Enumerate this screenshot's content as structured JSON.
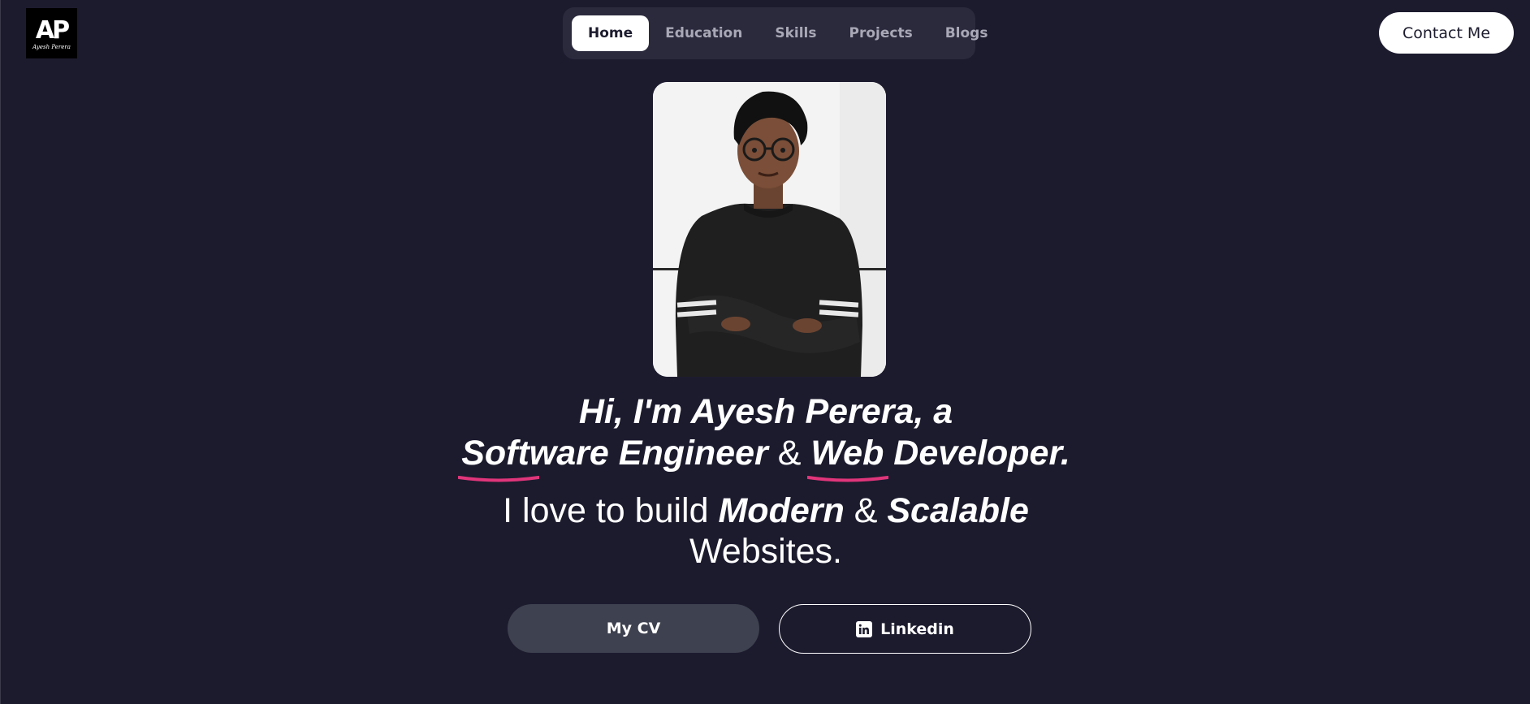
{
  "logo": {
    "mark": "AP",
    "signature": "Ayesh Perera"
  },
  "nav": {
    "items": [
      {
        "label": "Home",
        "active": true
      },
      {
        "label": "Education",
        "active": false
      },
      {
        "label": "Skills",
        "active": false
      },
      {
        "label": "Projects",
        "active": false
      },
      {
        "label": "Blogs",
        "active": false
      }
    ]
  },
  "header": {
    "contact_label": "Contact Me"
  },
  "hero": {
    "intro": "Hi, I'm Ayesh Perera, a",
    "role_1": "Software Engineer",
    "amp": "&",
    "role_2": "Web Developer.",
    "tagline_prefix": "I love to build",
    "tagline_emph_1": "Modern",
    "tagline_amp": "&",
    "tagline_emph_2": "Scalable",
    "tagline_suffix": "Websites."
  },
  "actions": {
    "cv_label": "My CV",
    "linkedin_label": "Linkedin",
    "linkedin_icon": "linkedin-icon"
  },
  "colors": {
    "background": "#1c1b2e",
    "nav_background": "#2b2a3d",
    "underline_accent": "#e0357a",
    "cv_button": "#3e414f"
  }
}
